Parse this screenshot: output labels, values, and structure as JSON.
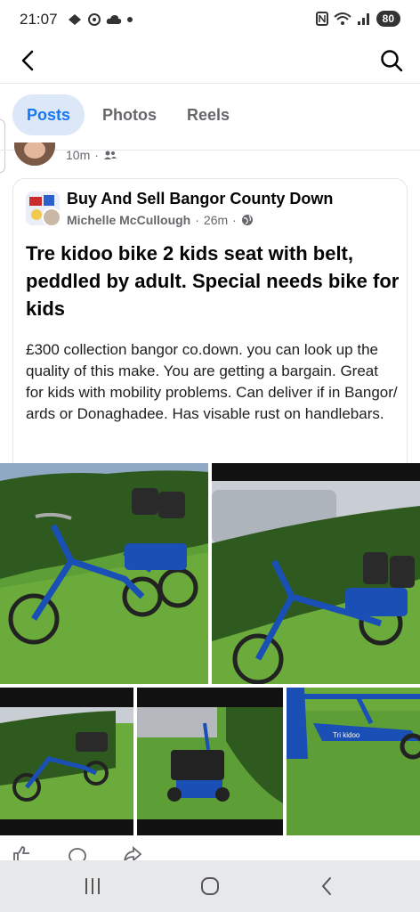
{
  "status_bar": {
    "time": "21:07",
    "battery": "80",
    "icons": [
      "notification-icons",
      "dot",
      "nfc-icon",
      "wifi-icon",
      "signal-icon",
      "battery-icon"
    ]
  },
  "tabs": [
    {
      "label": "Posts",
      "active": true
    },
    {
      "label": "Photos",
      "active": false
    },
    {
      "label": "Reels",
      "active": false
    }
  ],
  "previous_post": {
    "time": "10m"
  },
  "post": {
    "group_name": "Buy And Sell Bangor County Down",
    "author": "Michelle McCullough",
    "time": "26m",
    "privacy_icon": "globe-icon",
    "title": "Tre kidoo bike 2 kids seat with belt, peddled by adult. Special needs bike for kids",
    "body": "£300 collection bangor co.down. you can look up the quality of this make. You are getting a bargain. Great for kids with mobility problems. Can deliver if in Bangor/ ards or Donaghadee. Has visable rust on handlebars.",
    "photo_count": 5
  },
  "colors": {
    "accent": "#1877f2",
    "tab_active_bg": "#dce8f8",
    "text_secondary": "#65676b",
    "bike_blue": "#1a4fb5",
    "grass": "#5a9a32",
    "hedge": "#2f5a1f"
  }
}
